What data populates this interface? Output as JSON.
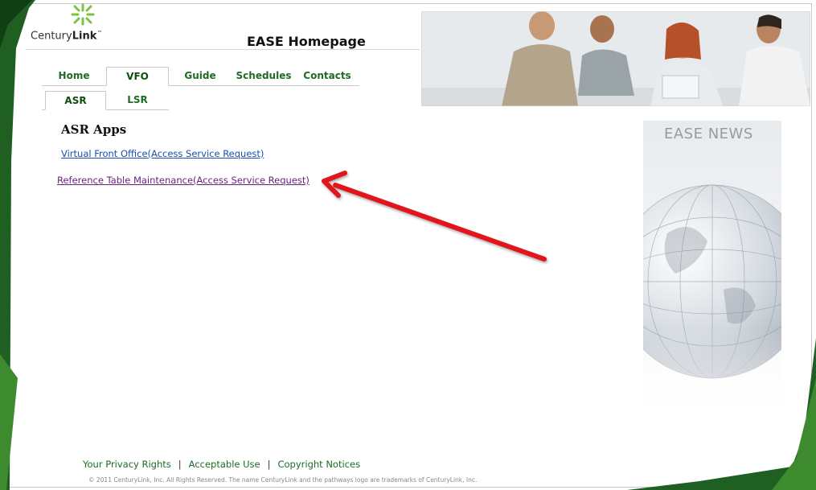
{
  "brand": {
    "logo_text_prefix": "Century",
    "logo_text_bold": "Link",
    "logo_mark": "™"
  },
  "header": {
    "title": "EASE Homepage"
  },
  "nav": {
    "tabs": [
      {
        "label": "Home",
        "active": false
      },
      {
        "label": "VFO",
        "active": true
      },
      {
        "label": "Guide",
        "active": false
      },
      {
        "label": "Schedules",
        "active": false
      },
      {
        "label": "Contacts",
        "active": false
      }
    ],
    "subtabs": [
      {
        "label": "ASR",
        "active": true
      },
      {
        "label": "LSR",
        "active": false
      }
    ]
  },
  "main": {
    "section_title": "ASR Apps",
    "links": [
      {
        "label": "Virtual Front Office(Access Service Request)"
      },
      {
        "label": "Reference Table Maintenance(Access Service Request)"
      }
    ]
  },
  "news": {
    "title": "EASE NEWS"
  },
  "footer": {
    "links": [
      "Your Privacy Rights",
      "Acceptable Use",
      "Copyright Notices"
    ],
    "separator": "|",
    "copyright": "© 2011 CenturyLink, Inc. All Rights Reserved. The name CenturyLink and the pathways logo are trademarks of CenturyLink, Inc."
  },
  "colors": {
    "brand_green": "#1e6b22",
    "dark_green": "#0b4d0e",
    "link_blue": "#1a4fb5",
    "link_visited": "#6b1f7a",
    "annotation_red": "#e0161b"
  },
  "icons": {
    "logo": "pathways-logo-icon",
    "hero": "business-meeting-photo",
    "news": "globe-image",
    "annotation": "red-arrow-icon"
  }
}
